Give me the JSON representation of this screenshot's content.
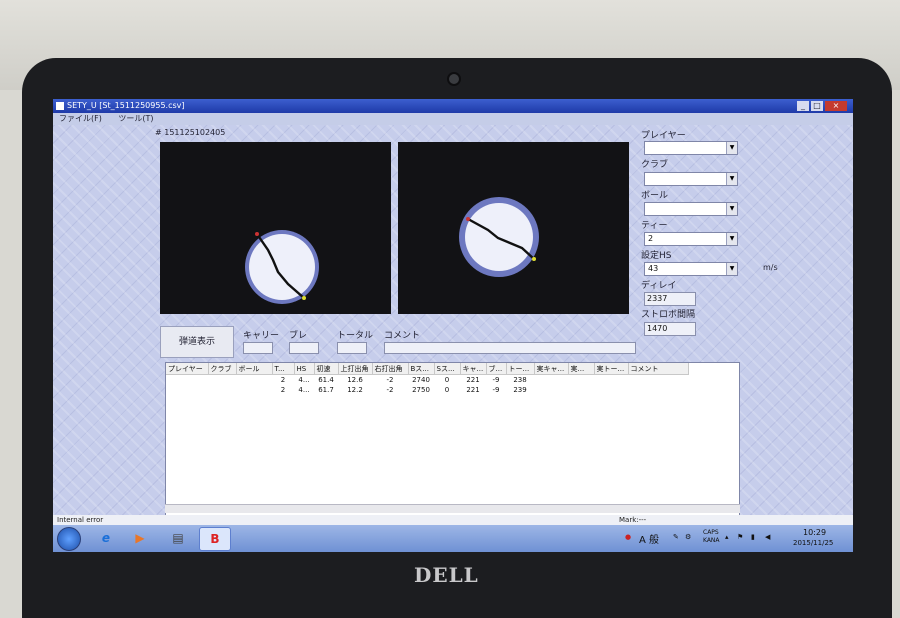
{
  "window": {
    "title": "SETY_U [St_1511250955.csv]",
    "min_glyph": "_",
    "max_glyph": "□",
    "close_glyph": "×"
  },
  "menu": {
    "file": "ファイル(F)",
    "tool": "ツール(T)"
  },
  "capture_id": "# 151125102405",
  "settings": {
    "player_label": "プレイヤー",
    "player_value": "",
    "club_label": "クラブ",
    "club_value": "",
    "ball_label": "ボール",
    "ball_value": "",
    "tee_label": "ティー",
    "tee_value": "2",
    "hs_label": "設定HS",
    "hs_value": "43",
    "hs_unit": "m/s",
    "delay_label": "ディレイ",
    "delay_value": "2337",
    "strobe_label": "ストロボ間隔",
    "strobe_value": "1470"
  },
  "controls": {
    "trajectory_button": "弾道表示",
    "carry_label": "キャリー",
    "blur_label": "ブレ",
    "total_label": "トータル",
    "comment_label": "コメント"
  },
  "table": {
    "headers": [
      "プレイヤー",
      "クラブ",
      "ボール",
      "T...",
      "HS",
      "初速",
      "上打出角",
      "右打出角",
      "Bス...",
      "Sス...",
      "キャ...",
      "ブ...",
      "トー...",
      "実キャ...",
      "実...",
      "実トー...",
      "コメント"
    ],
    "rows": [
      [
        "",
        "",
        "",
        "2",
        "4...",
        "61.4",
        "12.6",
        "-2",
        "2740",
        "0",
        "221",
        "-9",
        "238",
        "",
        "",
        "",
        ""
      ],
      [
        "",
        "",
        "",
        "2",
        "4...",
        "61.7",
        "12.2",
        "-2",
        "2750",
        "0",
        "221",
        "-9",
        "239",
        "",
        "",
        "",
        ""
      ]
    ]
  },
  "status": {
    "left": "Internal error",
    "right": "Mark:---"
  },
  "taskbar": {
    "ime": "A 般",
    "caps": "CAPS",
    "kana": "KANA",
    "time": "10:29",
    "date": "2015/11/25"
  },
  "hardware": {
    "brand": "DELL"
  },
  "colors": {
    "titlebar": "#2a48bd",
    "client": "#c6cdeb",
    "taskbar": "#7f9edb",
    "screen_black": "#121215"
  }
}
